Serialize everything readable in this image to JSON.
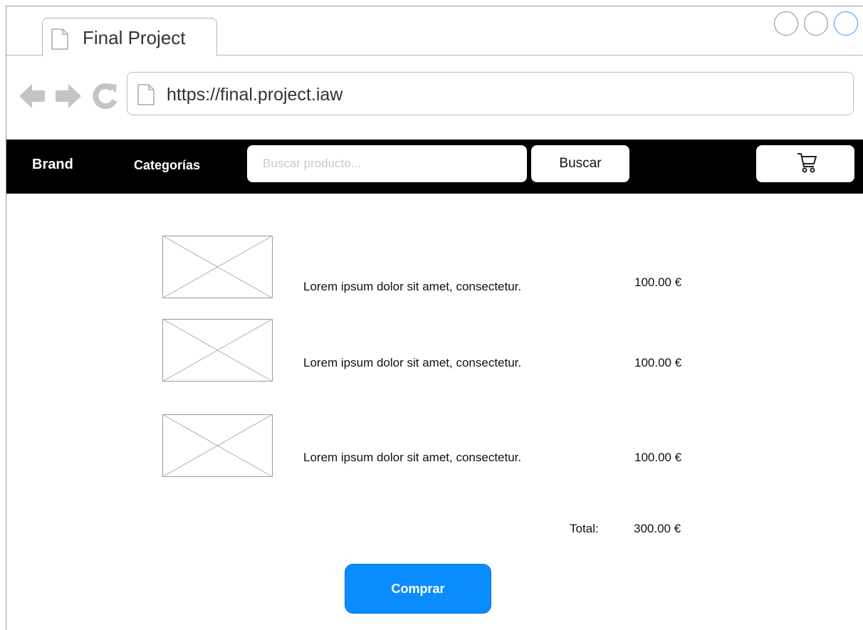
{
  "window": {
    "tab_title": "Final Project",
    "url": "https://final.project.iaw"
  },
  "navbar": {
    "brand": "Brand",
    "categories": "Categorías",
    "search_placeholder": "Buscar producto...",
    "search_button": "Buscar",
    "cart_icon": "shopping-cart-icon"
  },
  "cart": {
    "items": [
      {
        "description": "Lorem ipsum dolor sit amet, consectetur.",
        "price": "100.00 €"
      },
      {
        "description": "Lorem ipsum dolor sit amet, consectetur.",
        "price": "100.00 €"
      },
      {
        "description": "Lorem ipsum dolor sit amet, consectetur.",
        "price": "100.00 €"
      }
    ],
    "total_label": "Total:",
    "total_value": "300.00 €",
    "buy_button": "Comprar"
  },
  "colors": {
    "navbar_bg": "#000000",
    "buy_button": "#0a8cff",
    "active_window_button": "#2b9aff"
  }
}
